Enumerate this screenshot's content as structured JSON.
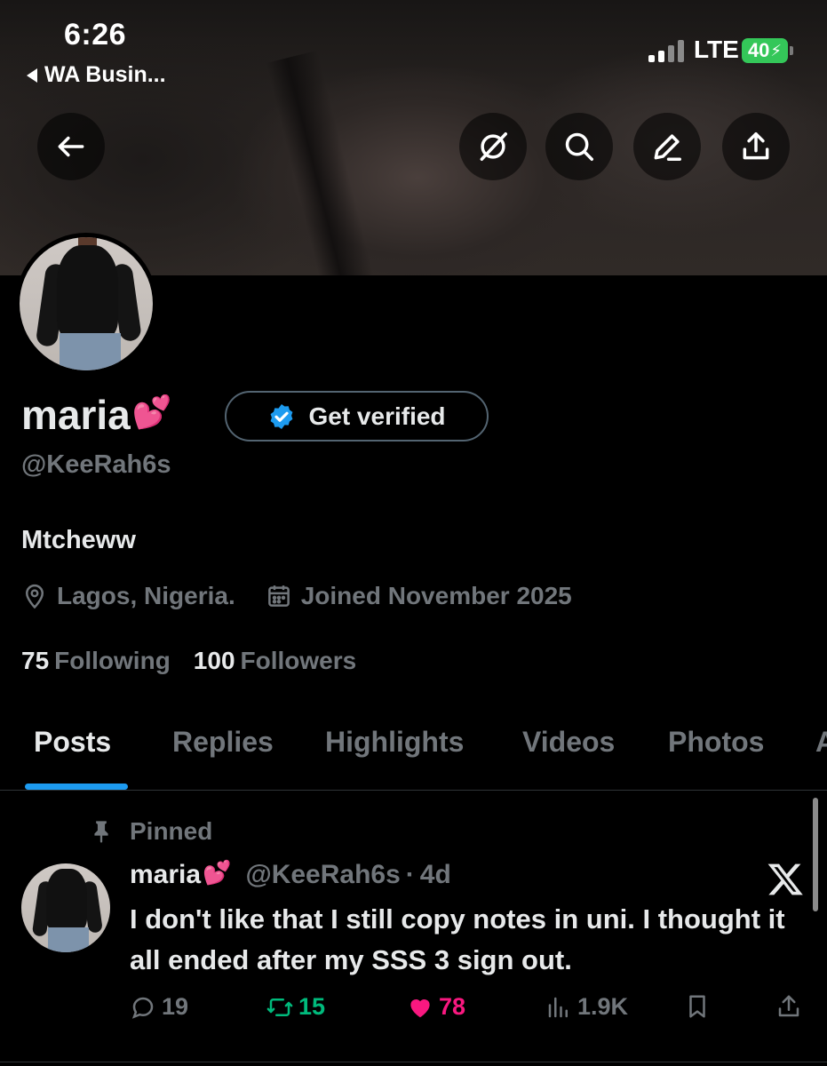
{
  "status_bar": {
    "time": "6:26",
    "back_app": "WA Busin...",
    "network": "LTE",
    "battery": "40"
  },
  "profile": {
    "display_name": "maria",
    "name_emoji": "💕",
    "get_verified_label": "Get verified",
    "handle": "@KeeRah6s",
    "bio": "Mtcheww",
    "location": "Lagos, Nigeria.",
    "joined": "Joined November 2025",
    "following_count": "75",
    "following_label": "Following",
    "followers_count": "100",
    "followers_label": "Followers"
  },
  "tabs": [
    "Posts",
    "Replies",
    "Highlights",
    "Videos",
    "Photos",
    "A"
  ],
  "post": {
    "pinned_label": "Pinned",
    "author_name": "maria",
    "author_emoji": "💕",
    "author_handle": "@KeeRah6s",
    "separator": "·",
    "time": "4d",
    "text": "I don't like that I still copy notes in uni. I thought it all ended after my SSS 3 sign out.",
    "replies": "19",
    "reposts": "15",
    "likes": "78",
    "views": "1.9K"
  },
  "colors": {
    "accent": "#1d9bf0",
    "repost": "#00ba7c",
    "like": "#f91880",
    "muted": "#71767b",
    "battery": "#34c759"
  },
  "icons": {
    "back": "arrow-left-icon",
    "grok": "grok-icon",
    "search": "search-icon",
    "edit": "pencil-icon",
    "share": "share-icon",
    "verified": "verified-badge-icon",
    "location": "location-pin-icon",
    "calendar": "calendar-icon",
    "pin": "pin-icon",
    "x_logo": "x-logo-icon",
    "reply": "reply-icon",
    "repost": "repost-icon",
    "like": "heart-icon",
    "views": "views-icon",
    "bookmark": "bookmark-icon"
  }
}
